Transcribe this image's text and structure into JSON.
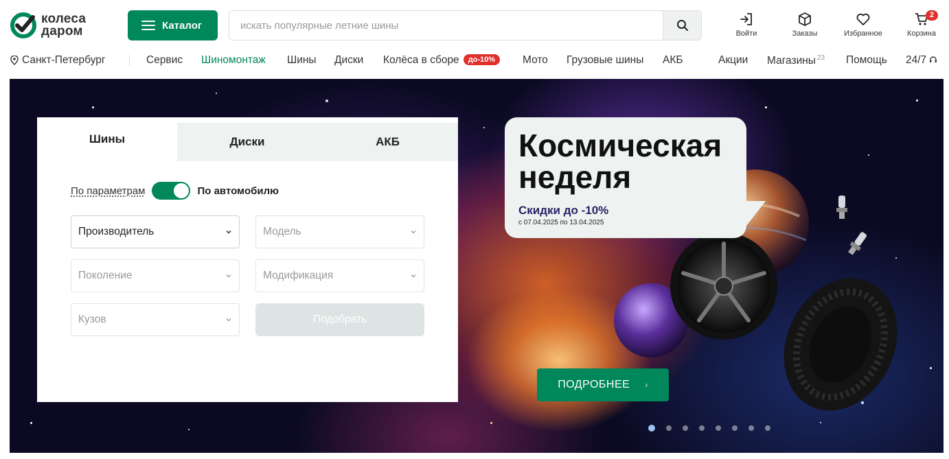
{
  "header": {
    "logo_line1": "колеса",
    "logo_line2": "даром",
    "catalog_label": "Каталог",
    "search_placeholder": "искать популярные летние шины",
    "icons": [
      {
        "name": "login",
        "label": "Войти"
      },
      {
        "name": "orders",
        "label": "Заказы"
      },
      {
        "name": "favorites",
        "label": "Избранное"
      },
      {
        "name": "cart",
        "label": "Корзина",
        "badge": "2"
      }
    ]
  },
  "nav": {
    "city": "Санкт-Петербург",
    "items": [
      {
        "label": "Сервис"
      },
      {
        "label": "Шиномонтаж",
        "active": true
      },
      {
        "label": "Шины"
      },
      {
        "label": "Диски"
      },
      {
        "label": "Колёса в сборе",
        "badge": "до-10%"
      },
      {
        "label": "Мото"
      },
      {
        "label": "Грузовые шины"
      },
      {
        "label": "АКБ"
      },
      {
        "label": "Акции"
      },
      {
        "label": "Магазины",
        "sup": "23"
      },
      {
        "label": "Помощь"
      },
      {
        "label": "24/7"
      }
    ]
  },
  "panel": {
    "tabs": [
      "Шины",
      "Диски",
      "АКБ"
    ],
    "active_tab": "Шины",
    "mode_params": "По параметрам",
    "mode_car": "По автомобилю",
    "selects": {
      "manufacturer": "Производитель",
      "model": "Модель",
      "generation": "Поколение",
      "modification": "Модификация",
      "body": "Кузов"
    },
    "pick_label": "Подобрать"
  },
  "promo": {
    "title_line1": "Космическая",
    "title_line2": "неделя",
    "discount": "Скидки до -10%",
    "dates": "с 07.04.2025 по 13.04.2025",
    "more_label": "ПОДРОБНЕЕ",
    "slides_total": 8,
    "active_slide": 1
  },
  "colors": {
    "brand_green": "#00875a",
    "badge_red": "#e0302b",
    "promo_text": "#2a2366"
  }
}
